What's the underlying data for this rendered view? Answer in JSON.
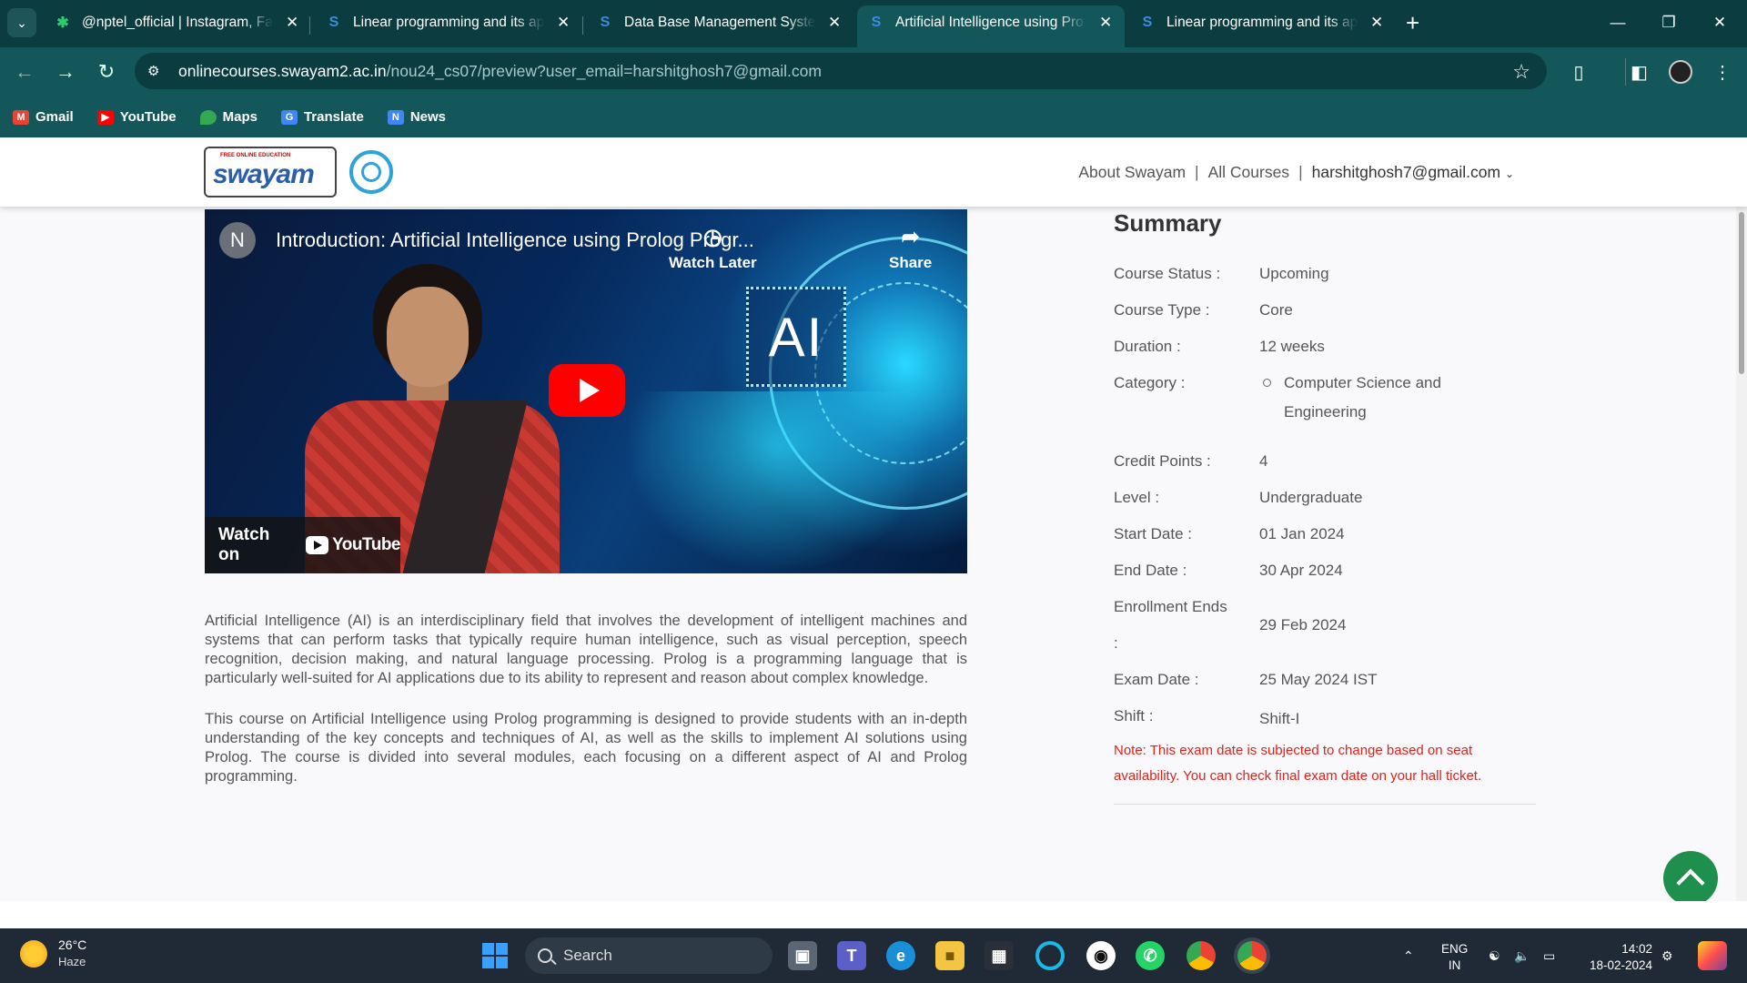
{
  "browser": {
    "tabs": [
      {
        "title": "@nptel_official | Instagram, Fa",
        "icon": "nptel-star-icon",
        "active": false
      },
      {
        "title": "Linear programming and its ap",
        "icon": "swayam-s-icon",
        "active": false
      },
      {
        "title": "Data Base Management Systen",
        "icon": "swayam-s-icon",
        "active": false
      },
      {
        "title": "Artificial Intelligence using Pro",
        "icon": "swayam-s-icon",
        "active": true
      },
      {
        "title": "Linear programming and its ap",
        "icon": "swayam-s-icon",
        "active": false
      }
    ],
    "url_host": "onlinecourses.swayam2.ac.in",
    "url_path": "/nou24_cs07/preview?user_email=harshitghosh7@gmail.com",
    "bookmarks": [
      {
        "label": "Gmail",
        "color": "#ea4335"
      },
      {
        "label": "YouTube",
        "color": "#ff0000"
      },
      {
        "label": "Maps",
        "color": "#34a853"
      },
      {
        "label": "Translate",
        "color": "#4285f4"
      },
      {
        "label": "News",
        "color": "#4285f4"
      }
    ]
  },
  "header": {
    "about": "About Swayam",
    "sep": "|",
    "all_courses": "All Courses",
    "email": "harshitghosh7@gmail.com"
  },
  "video": {
    "channel_initial": "N",
    "title": "Introduction: Artificial Intelligence using Prolog Progr...",
    "watch_later": "Watch Later",
    "share": "Share",
    "watch_on": "Watch on",
    "youtube": "YouTube",
    "ai_text": "AI"
  },
  "description": {
    "p1": "Artificial Intelligence (AI) is an interdisciplinary field that involves the development of intelligent machines and systems that can perform tasks that typically require human intelligence, such as visual perception, speech recognition, decision making, and natural language processing. Prolog is a programming language that is particularly well-suited for AI applications due to its ability to represent and reason about complex knowledge.",
    "p2": "This course on Artificial Intelligence using Prolog programming is designed to provide students with an in-depth understanding of the key concepts and techniques of AI, as well as the skills to implement AI solutions using Prolog. The course is divided into several modules, each focusing on a different aspect of AI and Prolog programming."
  },
  "summary": {
    "heading": "Summary",
    "course_status_label": "Course Status :",
    "course_status": "Upcoming",
    "course_type_label": "Course Type :",
    "course_type": "Core",
    "duration_label": "Duration :",
    "duration": "12 weeks",
    "category_label": "Category :",
    "category_line1": "Computer Science and",
    "category_line2": "Engineering",
    "credit_label": "Credit Points :",
    "credit": "4",
    "level_label": "Level :",
    "level": "Undergraduate",
    "start_label": "Start Date :",
    "start": "01 Jan 2024",
    "end_label": "End Date :",
    "end": "30 Apr 2024",
    "enroll_label": "Enrollment Ends",
    "enroll_colon": ":",
    "enroll": "29 Feb 2024",
    "exam_label": "Exam Date :",
    "exam": "25 May 2024 IST",
    "shift_label": "Shift :",
    "shift": "Shift-I",
    "note": "Note: This exam date is subjected to change based on seat availability. You can check final exam date on your hall ticket."
  },
  "taskbar": {
    "temp": "26°C",
    "weather": "Haze",
    "search": "Search",
    "lang1": "ENG",
    "lang2": "IN",
    "time": "14:02",
    "date": "18-02-2024"
  }
}
